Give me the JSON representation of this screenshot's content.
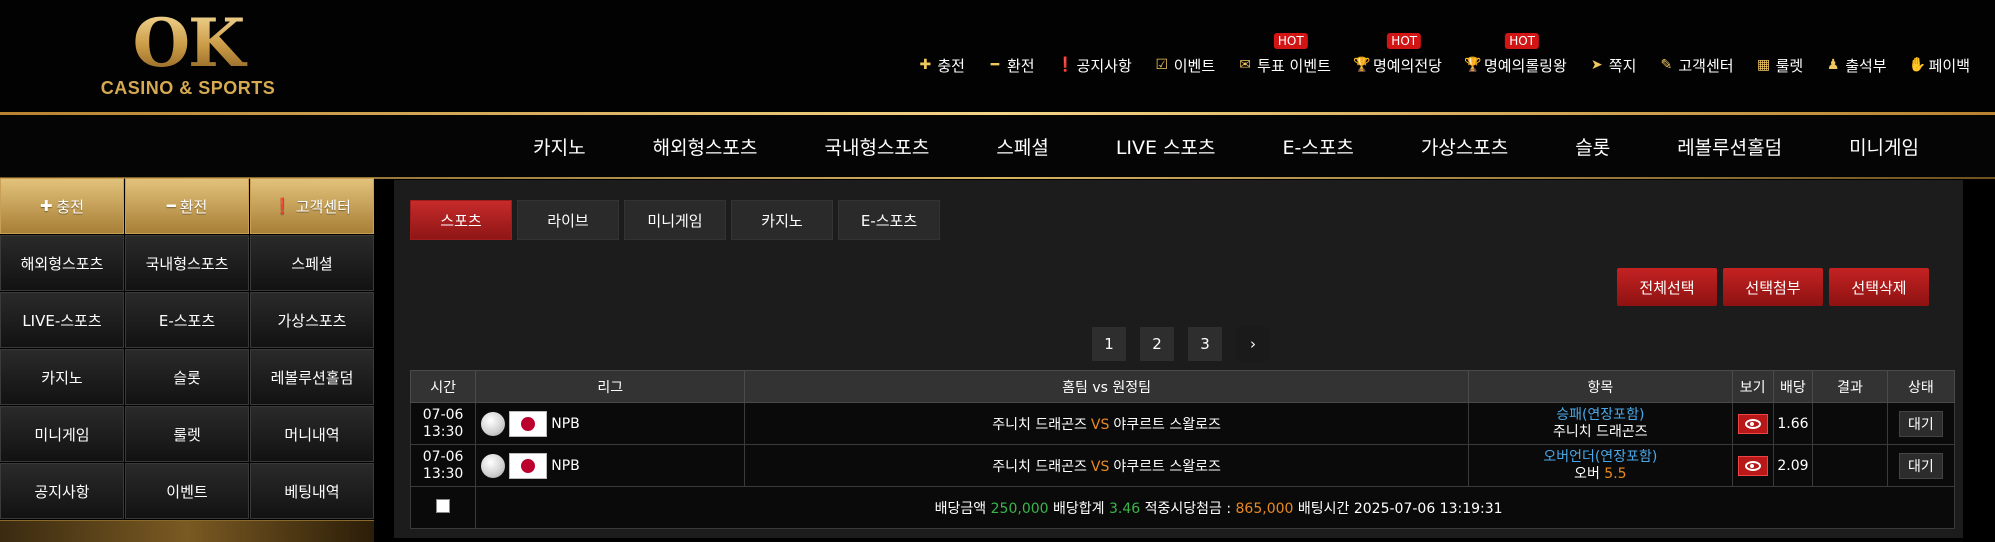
{
  "logo": {
    "text": "OK",
    "sub": "CASINO & SPORTS"
  },
  "topnav": [
    {
      "label": "충전",
      "icon": "plus-icon",
      "glyph": "✚",
      "hot": ""
    },
    {
      "label": "환전",
      "icon": "minus-icon",
      "glyph": "━",
      "hot": ""
    },
    {
      "label": "공지사항",
      "icon": "alert-circle-icon",
      "glyph": "❗",
      "hot": ""
    },
    {
      "label": "이벤트",
      "icon": "calendar-check-icon",
      "glyph": "☑",
      "hot": ""
    },
    {
      "label": "투표 이벤트",
      "icon": "vote-icon",
      "glyph": "✉",
      "hot": "HOT"
    },
    {
      "label": "명예의전당",
      "icon": "trophy-icon",
      "glyph": "🏆",
      "hot": "HOT"
    },
    {
      "label": "명예의롤링왕",
      "icon": "trophy-icon",
      "glyph": "🏆",
      "hot": "HOT"
    },
    {
      "label": "쪽지",
      "icon": "paper-plane-icon",
      "glyph": "➤",
      "hot": ""
    },
    {
      "label": "고객센터",
      "icon": "edit-icon",
      "glyph": "✎",
      "hot": ""
    },
    {
      "label": "룰렛",
      "icon": "roulette-icon",
      "glyph": "▦",
      "hot": ""
    },
    {
      "label": "출석부",
      "icon": "stamp-icon",
      "glyph": "♟",
      "hot": ""
    },
    {
      "label": "페이백",
      "icon": "payback-icon",
      "glyph": "✋",
      "hot": ""
    }
  ],
  "mainnav": [
    "카지노",
    "해외형스포츠",
    "국내형스포츠",
    "스페셜",
    "LIVE 스포츠",
    "E-스포츠",
    "가상스포츠",
    "슬롯",
    "레볼루션홀덤",
    "미니게임"
  ],
  "sidebar": {
    "top": [
      {
        "label": "충전",
        "icon": "plus-icon",
        "glyph": "✚"
      },
      {
        "label": "환전",
        "icon": "minus-icon",
        "glyph": "━"
      },
      {
        "label": "고객센터",
        "icon": "alert-circle-icon",
        "glyph": "❗"
      }
    ],
    "rows": [
      [
        "해외형스포츠",
        "국내형스포츠",
        "스페셜"
      ],
      [
        "LIVE-스포츠",
        "E-스포츠",
        "가상스포츠"
      ],
      [
        "카지노",
        "슬롯",
        "레볼루션홀덤"
      ],
      [
        "미니게임",
        "룰렛",
        "머니내역"
      ],
      [
        "공지사항",
        "이벤트",
        "베팅내역"
      ]
    ]
  },
  "tabs": [
    "스포츠",
    "라이브",
    "미니게임",
    "카지노",
    "E-스포츠"
  ],
  "active_tab": 0,
  "actions": [
    "전체선택",
    "선택첨부",
    "선택삭제"
  ],
  "pager": [
    "1",
    "2",
    "3",
    "›"
  ],
  "table": {
    "headers": [
      "시간",
      "리그",
      "홈팀 vs 원정팀",
      "항목",
      "보기",
      "배당",
      "결과",
      "상태"
    ],
    "rows": [
      {
        "date": "07-06",
        "time": "13:30",
        "league": "NPB",
        "home": "주니치 드래곤즈",
        "vs": "VS",
        "away": "야쿠르트 스왈로즈",
        "pick_type": "승패(연장포함)",
        "pick_sel": "주니치 드래곤즈",
        "pick_extra": "",
        "odds": "1.66",
        "result": "",
        "status": "대기"
      },
      {
        "date": "07-06",
        "time": "13:30",
        "league": "NPB",
        "home": "주니치 드래곤즈",
        "vs": "VS",
        "away": "야쿠르트 스왈로즈",
        "pick_type": "오버언더(연장포함)",
        "pick_sel": "오버",
        "pick_extra": "5.5",
        "odds": "2.09",
        "result": "",
        "status": "대기"
      }
    ],
    "summary": {
      "bet_label": "배당금액",
      "bet_amount": "250,000",
      "odds_label": "배당합계",
      "odds_total": "3.46",
      "win_label": "적중시당첨금 :",
      "win_amount": "865,000",
      "time_label": "배팅시간",
      "time_value": "2025-07-06 13:19:31"
    }
  }
}
